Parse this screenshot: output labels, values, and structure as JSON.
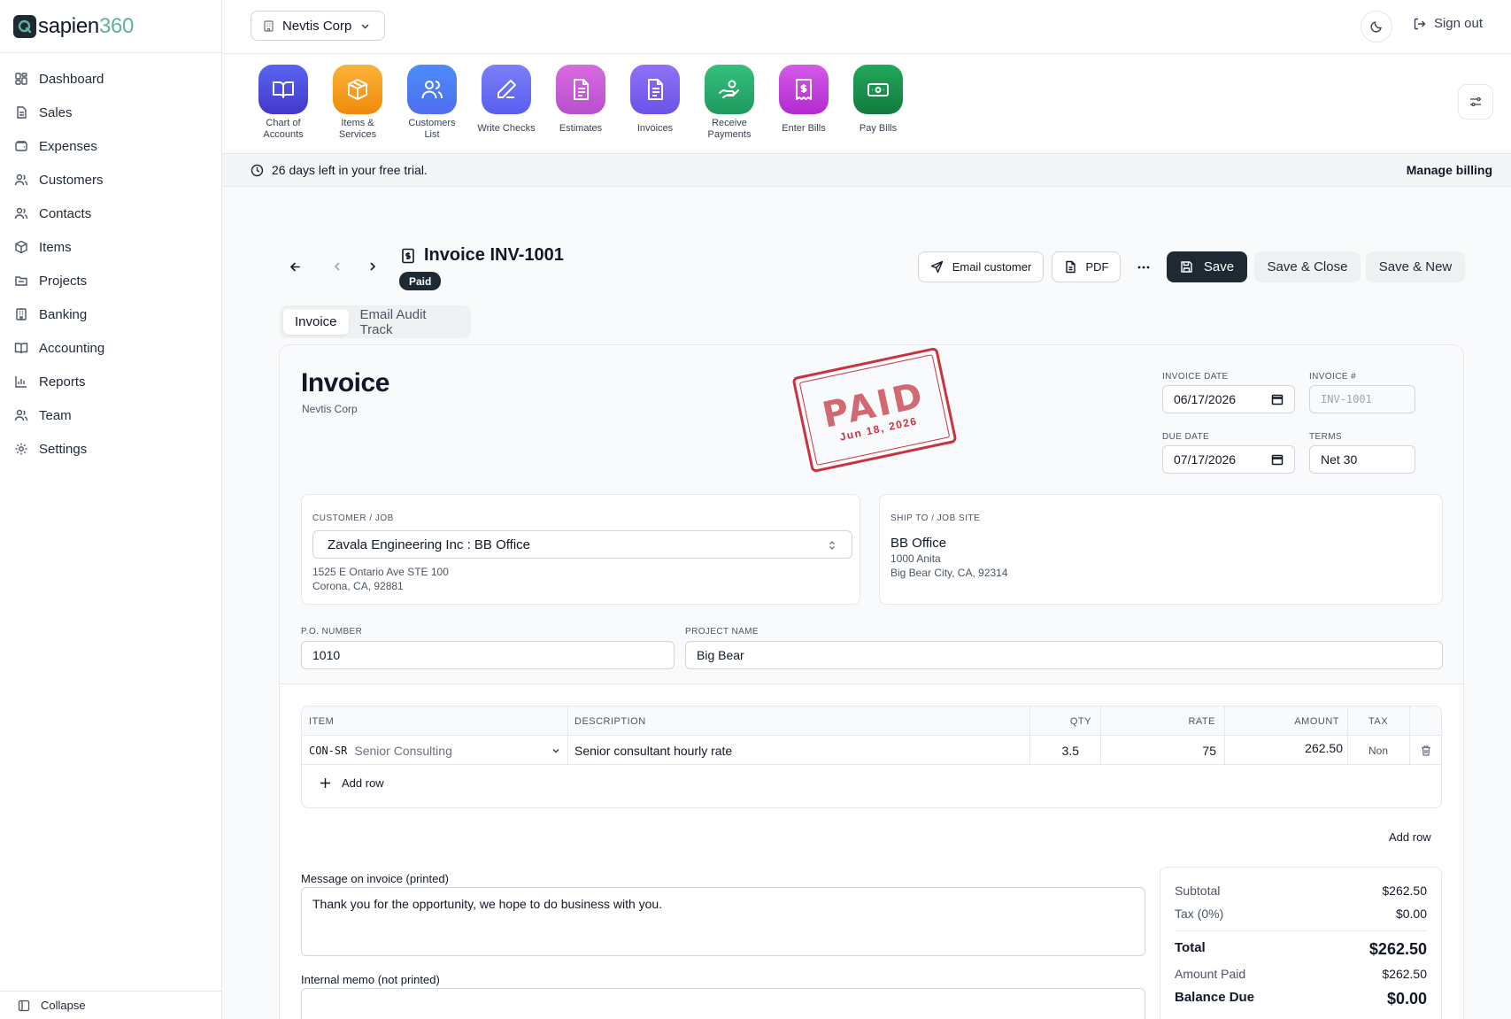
{
  "brand": {
    "part1": "sapien",
    "part2": "360",
    "accent": "#5fb39a"
  },
  "sidebar": {
    "items": [
      {
        "label": "Dashboard",
        "icon": "dashboard-icon"
      },
      {
        "label": "Sales",
        "icon": "receipt-icon"
      },
      {
        "label": "Expenses",
        "icon": "wallet-icon"
      },
      {
        "label": "Customers",
        "icon": "users-icon"
      },
      {
        "label": "Contacts",
        "icon": "contacts-icon"
      },
      {
        "label": "Items",
        "icon": "box-icon"
      },
      {
        "label": "Projects",
        "icon": "folder-icon"
      },
      {
        "label": "Banking",
        "icon": "bank-icon"
      },
      {
        "label": "Accounting",
        "icon": "book-icon"
      },
      {
        "label": "Reports",
        "icon": "chart-icon"
      },
      {
        "label": "Team",
        "icon": "team-icon"
      },
      {
        "label": "Settings",
        "icon": "gear-icon"
      }
    ],
    "collapse_label": "Collapse"
  },
  "topbar": {
    "company": "Nevtis Corp",
    "sign_out": "Sign out"
  },
  "shortcuts": [
    {
      "label": "Chart of Accounts",
      "color": "#4f46e5",
      "icon": "book-open-icon"
    },
    {
      "label": "Items & Services",
      "color": "#f59e0b",
      "icon": "package-icon"
    },
    {
      "label": "Customers List",
      "color": "#3b82f6",
      "icon": "users-icon"
    },
    {
      "label": "Write Checks",
      "color": "#6366f1",
      "icon": "pen-icon"
    },
    {
      "label": "Estimates",
      "color": "#c04fd0",
      "icon": "document-icon"
    },
    {
      "label": "Invoices",
      "color": "#7c5cf0",
      "icon": "document-icon"
    },
    {
      "label": "Receive Payments",
      "color": "#22a068",
      "icon": "hand-coins-icon"
    },
    {
      "label": "Enter Bills",
      "color": "#c026d3",
      "icon": "bill-icon"
    },
    {
      "label": "Pay Bills",
      "color": "#16a34a",
      "icon": "banknote-icon"
    }
  ],
  "trial": {
    "text": "26 days left in your free trial.",
    "manage": "Manage billing"
  },
  "invoice_header": {
    "title": "Invoice INV-1001",
    "status": "Paid",
    "email_customer": "Email customer",
    "pdf": "PDF",
    "save": "Save",
    "save_close": "Save & Close",
    "save_new": "Save & New"
  },
  "tabs": [
    {
      "label": "Invoice"
    },
    {
      "label": "Email Audit Track"
    }
  ],
  "invoice": {
    "title": "Invoice",
    "company": "Nevtis Corp",
    "stamp_word": "PAID",
    "stamp_date": "Jun 18, 2026",
    "invoice_date_label": "INVOICE DATE",
    "invoice_date": "06/17/2026",
    "invoice_no_label": "INVOICE #",
    "invoice_no_placeholder": "INV-1001",
    "due_date_label": "DUE DATE",
    "due_date": "07/17/2026",
    "terms_label": "TERMS",
    "terms": "Net 30",
    "customer_label": "CUSTOMER / JOB",
    "customer": "Zavala Engineering Inc : BB Office",
    "customer_addr1": "1525 E Ontario Ave STE 100",
    "customer_addr2": "Corona, CA, 92881",
    "ship_label": "SHIP TO / JOB SITE",
    "ship_name": "BB Office",
    "ship_addr1": "1000 Anita",
    "ship_addr2": "Big Bear City, CA, 92314",
    "po_label": "P.O. NUMBER",
    "po": "1010",
    "project_label": "PROJECT NAME",
    "project": "Big Bear"
  },
  "table": {
    "headers": {
      "item": "ITEM",
      "description": "DESCRIPTION",
      "qty": "QTY",
      "rate": "RATE",
      "amount": "AMOUNT",
      "tax": "TAX"
    },
    "rows": [
      {
        "code": "CON-SR",
        "name": "Senior Consulting",
        "description": "Senior consultant hourly rate",
        "qty": "3.5",
        "rate": "75",
        "amount": "262.50",
        "tax": "Non"
      }
    ],
    "add_row": "Add row",
    "add_row_secondary": "Add row"
  },
  "message": {
    "label": "Message on invoice (printed)",
    "text": "Thank you for the opportunity, we hope to do business with you.",
    "memo_label": "Internal memo (not printed)"
  },
  "totals": {
    "subtotal_label": "Subtotal",
    "subtotal": "$262.50",
    "tax_label": "Tax (0%)",
    "tax": "$0.00",
    "total_label": "Total",
    "total": "$262.50",
    "paid_label": "Amount Paid",
    "paid": "$262.50",
    "balance_label": "Balance Due",
    "balance": "$0.00"
  }
}
